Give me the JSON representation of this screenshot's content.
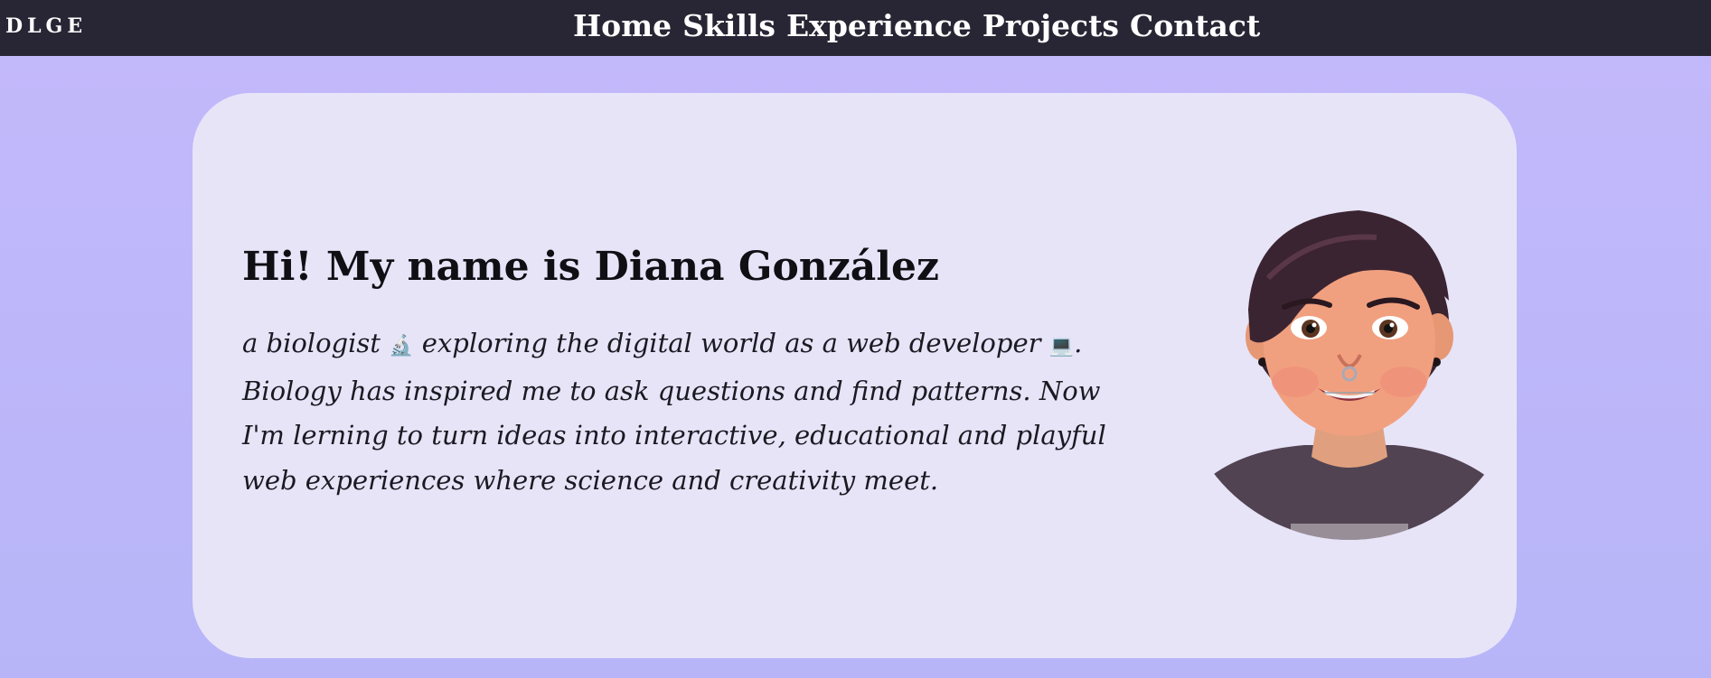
{
  "header": {
    "logo": "DLGE",
    "nav": [
      "Home",
      "Skills",
      "Experience",
      "Projects",
      "Contact"
    ]
  },
  "hero": {
    "title": "Hi! My name is Diana González",
    "bio_part1": "a biologist ",
    "bio_emoji1": "🔬",
    "bio_part2": " exploring the digital world as a web developer ",
    "bio_emoji2": "💻",
    "bio_part3": ". Biology has inspired me to ask questions and find patterns. Now I'm lerning to turn ideas into interactive, educational and playful web experiences where science and creativity meet.",
    "avatar_icon": "avatar-illustration"
  },
  "colors": {
    "page_bg": "#c3b9fb",
    "topbar_bg": "#282634",
    "card_bg": "#e7e4f8",
    "text": "#0f0f14"
  }
}
